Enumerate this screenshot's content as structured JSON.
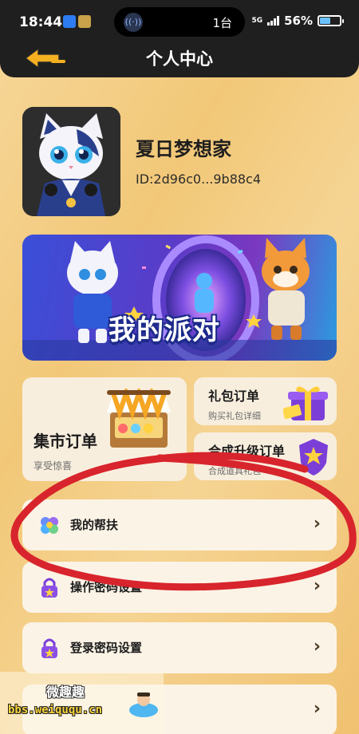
{
  "status_bar": {
    "time": "18:44",
    "island_count": "1台",
    "network": "5G",
    "battery": "56%",
    "battery_level": 0.56
  },
  "header": {
    "title": "个人中心",
    "back_icon": "back-arrow-icon"
  },
  "profile": {
    "nickname": "夏日梦想家",
    "id": "ID:2d96c0...9b88c4"
  },
  "banner": {
    "title": "我的派对"
  },
  "cards": {
    "market": {
      "title": "集市订单",
      "subtitle": "享受惊喜"
    },
    "gift": {
      "title": "礼包订单",
      "subtitle": "购买礼包详细"
    },
    "synthesis": {
      "title": "合成升级订单",
      "subtitle": "合成道具礼包"
    }
  },
  "menu": [
    {
      "label": "我的帮扶",
      "icon": "flower-icon"
    },
    {
      "label": "操作密码设置",
      "icon": "lock-icon"
    },
    {
      "label": "登录密码设置",
      "icon": "lock-icon"
    },
    {
      "label": "",
      "icon": ""
    }
  ],
  "annotation": {
    "color": "#d8242c"
  },
  "watermark": {
    "top": "微趣趣",
    "url": "bbs.weiququ.cn"
  },
  "colors": {
    "header_bg": "#1f1f1f",
    "page_bg": "#f2c878",
    "card_bg": "#f8eede",
    "accent": "#f5b021"
  }
}
